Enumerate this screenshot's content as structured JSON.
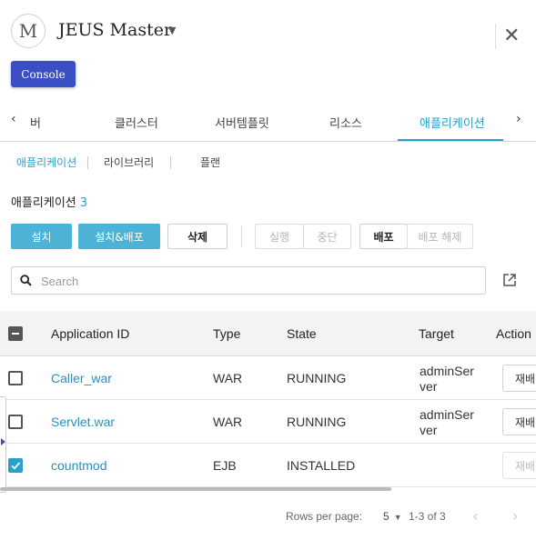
{
  "header": {
    "avatar_letter": "M",
    "title": "JEUS Master",
    "console_label": "Console"
  },
  "tabs": {
    "items": [
      {
        "label": "버"
      },
      {
        "label": "클러스터"
      },
      {
        "label": "서버템플릿"
      },
      {
        "label": "리소스"
      },
      {
        "label": "애플리케이션",
        "active": true
      }
    ]
  },
  "subtabs": {
    "items": [
      {
        "label": "애플리케이션",
        "active": true
      },
      {
        "label": "라이브러리"
      },
      {
        "label": "플랜"
      }
    ]
  },
  "section": {
    "title": "애플리케이션",
    "count": "3"
  },
  "toolbar": {
    "install": "설치",
    "install_deploy": "설치&배포",
    "delete": "삭제",
    "run": "실행",
    "stop": "중단",
    "deploy": "배포",
    "undeploy": "배포 해제"
  },
  "search": {
    "placeholder": "Search"
  },
  "table": {
    "headers": {
      "id": "Application ID",
      "type": "Type",
      "state": "State",
      "target": "Target",
      "action": "Action"
    },
    "rows": [
      {
        "id": "Caller_war",
        "type": "WAR",
        "state": "RUNNING",
        "target": "adminServer",
        "action": "재배",
        "checked": false
      },
      {
        "id": "Servlet.war",
        "type": "WAR",
        "state": "RUNNING",
        "target": "adminServer",
        "action": "재배",
        "checked": false
      },
      {
        "id": "countmod",
        "type": "EJB",
        "state": "INSTALLED",
        "target": "",
        "action": "재배",
        "checked": true
      }
    ]
  },
  "pagination": {
    "rows_per_page_label": "Rows per page:",
    "rows_per_page": "5",
    "range": "1-3 of 3"
  },
  "colors": {
    "accent": "#2a9fc9",
    "console": "#3a4fc5",
    "primary_button": "#4cb2d6"
  }
}
